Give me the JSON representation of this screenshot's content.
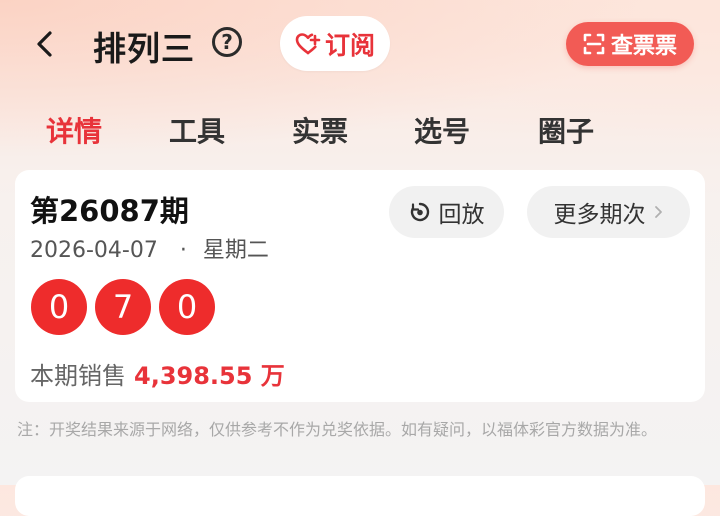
{
  "header": {
    "title": "排列三",
    "help_glyph": "?",
    "subscribe_label": "订阅",
    "ticket_label": "查票票"
  },
  "tabs": [
    {
      "label": "详情",
      "active": true
    },
    {
      "label": "工具",
      "active": false
    },
    {
      "label": "实票",
      "active": false
    },
    {
      "label": "选号",
      "active": false
    },
    {
      "label": "圈子",
      "active": false
    }
  ],
  "draw": {
    "period": "第26087期",
    "date": "2026-04-07",
    "separator": "·",
    "weekday": "星期二",
    "replay_label": "回放",
    "more_label": "更多期次",
    "balls": [
      "0",
      "7",
      "0"
    ],
    "sales_label": "本期销售",
    "sales_amount": "4,398.55 万"
  },
  "note": "注：开奖结果来源于网络，仅供参考不作为兑奖依据。如有疑问，以福体彩官方数据为准。",
  "colors": {
    "accent": "#e8333a",
    "ball": "#ee2c2c",
    "ticket_button": "#f25b55"
  },
  "icons": {
    "back": "chevron-left-icon",
    "help": "question-circle-icon",
    "subscribe": "heart-plus-icon",
    "ticket": "scan-icon",
    "replay": "replay-icon",
    "more": "chevron-right-icon"
  }
}
